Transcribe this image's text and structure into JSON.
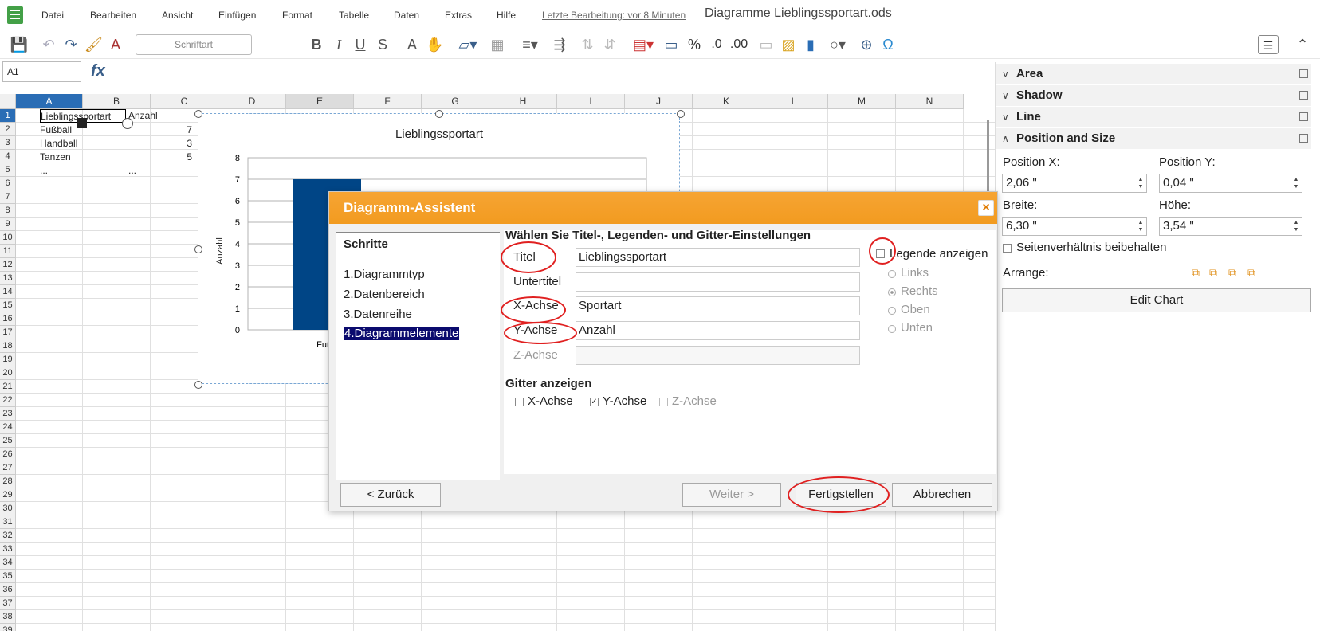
{
  "menubar": {
    "items": [
      "Datei",
      "Bearbeiten",
      "Ansicht",
      "Einfügen",
      "Format",
      "Tabelle",
      "Daten",
      "Extras",
      "Hilfe"
    ],
    "last_edit": "Letzte Bearbeitung: vor 8 Minuten",
    "doc_title": "Diagramme Lieblingssportart.ods"
  },
  "toolbar": {
    "font_placeholder": "Schriftart"
  },
  "formula": {
    "cell_ref": "A1",
    "fx": "fx"
  },
  "sheet": {
    "columns": [
      "A",
      "B",
      "C",
      "D",
      "E",
      "F",
      "G",
      "H",
      "I",
      "J",
      "K",
      "L",
      "M",
      "N"
    ],
    "rows": [
      "1",
      "2",
      "3",
      "4",
      "5",
      "6",
      "7",
      "8",
      "9",
      "10",
      "11",
      "12",
      "13",
      "14",
      "15",
      "16",
      "17",
      "18",
      "19",
      "20",
      "21",
      "22",
      "23",
      "24",
      "25",
      "26",
      "27",
      "28",
      "29",
      "30",
      "31",
      "32",
      "33",
      "34",
      "35",
      "36",
      "37",
      "38",
      "39"
    ],
    "cells": {
      "a1": "Lieblingssportart",
      "b1": "Anzahl",
      "a2": "Fußball",
      "b2": "7",
      "a3": "Handball",
      "b3": "3",
      "a4": "Tanzen",
      "b4": "5",
      "a5": "...",
      "b5": "..."
    }
  },
  "chart_data": {
    "type": "bar",
    "title": "Lieblingssportart",
    "ylabel": "Anzahl",
    "xlabel": "",
    "categories": [
      "Fußb"
    ],
    "values": [
      7
    ],
    "ylim": [
      0,
      8
    ],
    "yticks": [
      "0",
      "1",
      "2",
      "3",
      "4",
      "5",
      "6",
      "7",
      "8"
    ],
    "bar_color": "#004586"
  },
  "sidebar": {
    "sections": [
      "Area",
      "Shadow",
      "Line",
      "Position and Size"
    ],
    "pos_x_label": "Position X:",
    "pos_y_label": "Position Y:",
    "pos_x": "2,06 \"",
    "pos_y": "0,04 \"",
    "width_label": "Breite:",
    "height_label": "Höhe:",
    "width": "6,30 \"",
    "height": "3,54 \"",
    "keep_ratio": "Seitenverhältnis beibehalten",
    "arrange": "Arrange:",
    "edit_chart": "Edit Chart"
  },
  "dialog": {
    "title": "Diagramm-Assistent",
    "steps_heading": "Schritte",
    "steps": [
      "1.Diagrammtyp",
      "2.Datenbereich",
      "3.Datenreihe",
      "4.Diagrammelemente"
    ],
    "heading": "Wählen Sie Titel-, Legenden- und Gitter-Einstellungen",
    "titel_label": "Titel",
    "titel_value": "Lieblingssportart",
    "untertitel_label": "Untertitel",
    "untertitel_value": "",
    "xachse_label": "X-Achse",
    "xachse_value": "Sportart",
    "yachse_label": "Y-Achse",
    "yachse_value": "Anzahl",
    "zachse_label": "Z-Achse",
    "zachse_value": "",
    "legend_label": "Legende anzeigen",
    "legend_options": [
      "Links",
      "Rechts",
      "Oben",
      "Unten"
    ],
    "grid_heading": "Gitter anzeigen",
    "grid_x": "X-Achse",
    "grid_y": "Y-Achse",
    "grid_z": "Z-Achse",
    "back": "< Zurück",
    "next": "Weiter >",
    "finish": "Fertigstellen",
    "cancel": "Abbrechen"
  }
}
